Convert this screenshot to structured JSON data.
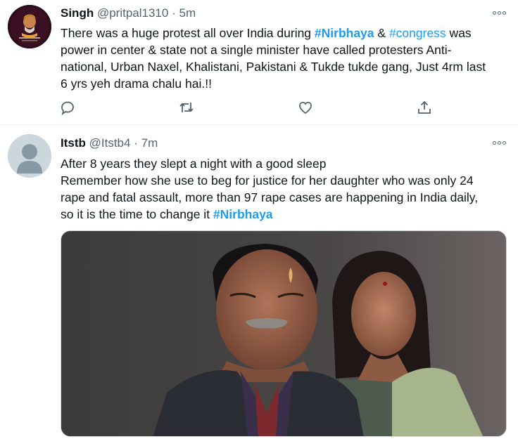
{
  "tweets": [
    {
      "name": "Singh",
      "handle": "@pritpal1310",
      "separator": "·",
      "time": "5m",
      "text": {
        "l1_a": "There was a huge protest all over India during ",
        "l1_tag1": "#Nirbhaya",
        "l1_b": " & ",
        "l1_tag2": "#congress",
        "l1_c": " was",
        "l2": "power in center & state not a single minister have called protesters Anti-",
        "l3": "national, Urban Naxel, Khalistani, Pakistani & Tukde tukde gang, Just 4rm last",
        "l4": "6 yrs yeh drama chalu hai.!!"
      },
      "icons": [
        "reply-icon",
        "retweet-icon",
        "like-icon",
        "share-icon"
      ]
    },
    {
      "name": "Itstb",
      "handle": "@Itstb4",
      "separator": "·",
      "time": "7m",
      "text": {
        "l1": "After 8 years they slept a night with a good sleep",
        "l2": "Remember how she use to beg for justice for her daughter who was only 24",
        "l3": "rape and fatal assault, more than 97 rape cases are happening in India daily,",
        "l4_a": "so it is the time to change it ",
        "l4_tag": "#Nirbhaya"
      },
      "media": "photo of a man and a woman"
    }
  ],
  "colors": {
    "link": "#1d9bf0",
    "text": "#0f1419",
    "secondary": "#536471",
    "divider": "#eff3f4"
  }
}
